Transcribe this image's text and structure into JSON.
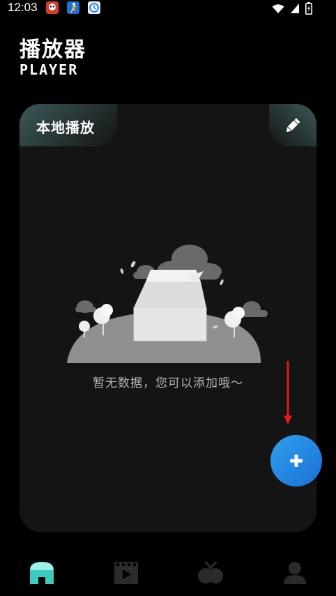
{
  "status": {
    "time": "12:03",
    "icons": [
      "app-notification-icon",
      "app-notification-icon",
      "app-notification-icon",
      "wifi-icon",
      "signal-icon",
      "battery-charging-icon"
    ]
  },
  "header": {
    "title": "播放器",
    "subtitle": "PLAYER"
  },
  "card": {
    "tab_label": "本地播放",
    "edit_icon": "pencil-icon",
    "empty_message": "暂无数据，您可以添加哦～"
  },
  "fab": {
    "icon": "plus-icon"
  },
  "bottom_nav": {
    "items": [
      {
        "icon": "home-icon",
        "active": true
      },
      {
        "icon": "video-icon",
        "active": false
      },
      {
        "icon": "fruit-icon",
        "active": false
      },
      {
        "icon": "user-icon",
        "active": false
      }
    ]
  },
  "colors": {
    "background": "#000000",
    "card": "#141414",
    "accent": "#1e88e5",
    "nav_active": "#7fe3da",
    "nav_inactive": "#2b2b2b",
    "annotation_arrow": "#e0191a"
  }
}
